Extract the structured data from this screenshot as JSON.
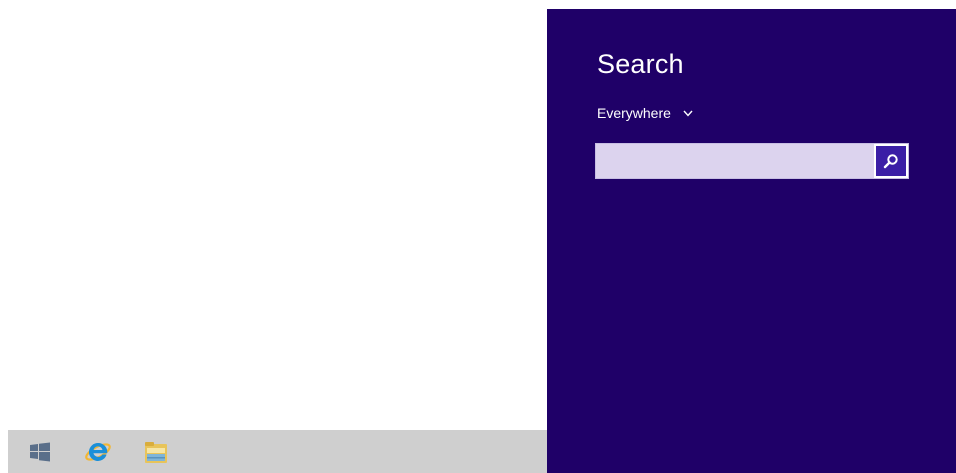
{
  "search_charm": {
    "title": "Search",
    "scope_label": "Everywhere",
    "scope_chevron_icon": "chevron-down-icon",
    "search_input": {
      "value": "",
      "placeholder": ""
    },
    "search_button_icon": "search-icon",
    "background_color": "#1f0068"
  },
  "taskbar": {
    "items": [
      {
        "icon": "windows-start-icon"
      },
      {
        "icon": "internet-explorer-icon"
      },
      {
        "icon": "file-explorer-icon"
      }
    ],
    "background_color": "#cfcfcf"
  }
}
